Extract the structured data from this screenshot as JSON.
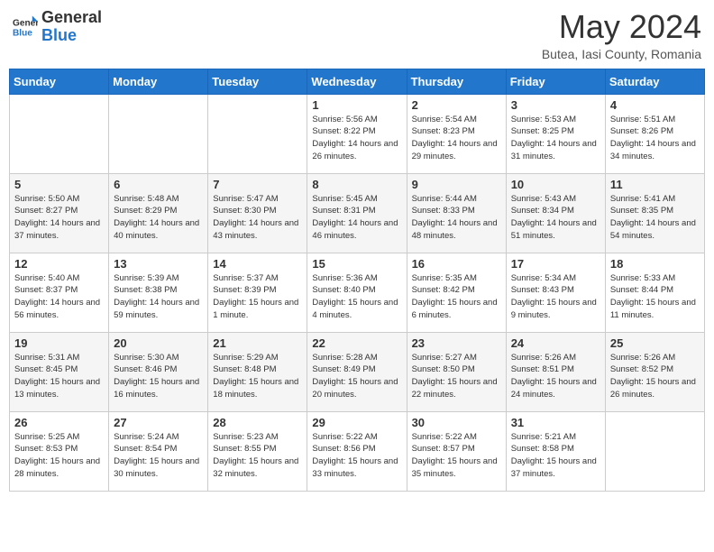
{
  "header": {
    "logo_text_general": "General",
    "logo_text_blue": "Blue",
    "month": "May 2024",
    "location": "Butea, Iasi County, Romania"
  },
  "weekdays": [
    "Sunday",
    "Monday",
    "Tuesday",
    "Wednesday",
    "Thursday",
    "Friday",
    "Saturday"
  ],
  "weeks": [
    [
      {
        "day": "",
        "info": ""
      },
      {
        "day": "",
        "info": ""
      },
      {
        "day": "",
        "info": ""
      },
      {
        "day": "1",
        "info": "Sunrise: 5:56 AM\nSunset: 8:22 PM\nDaylight: 14 hours\nand 26 minutes."
      },
      {
        "day": "2",
        "info": "Sunrise: 5:54 AM\nSunset: 8:23 PM\nDaylight: 14 hours\nand 29 minutes."
      },
      {
        "day": "3",
        "info": "Sunrise: 5:53 AM\nSunset: 8:25 PM\nDaylight: 14 hours\nand 31 minutes."
      },
      {
        "day": "4",
        "info": "Sunrise: 5:51 AM\nSunset: 8:26 PM\nDaylight: 14 hours\nand 34 minutes."
      }
    ],
    [
      {
        "day": "5",
        "info": "Sunrise: 5:50 AM\nSunset: 8:27 PM\nDaylight: 14 hours\nand 37 minutes."
      },
      {
        "day": "6",
        "info": "Sunrise: 5:48 AM\nSunset: 8:29 PM\nDaylight: 14 hours\nand 40 minutes."
      },
      {
        "day": "7",
        "info": "Sunrise: 5:47 AM\nSunset: 8:30 PM\nDaylight: 14 hours\nand 43 minutes."
      },
      {
        "day": "8",
        "info": "Sunrise: 5:45 AM\nSunset: 8:31 PM\nDaylight: 14 hours\nand 46 minutes."
      },
      {
        "day": "9",
        "info": "Sunrise: 5:44 AM\nSunset: 8:33 PM\nDaylight: 14 hours\nand 48 minutes."
      },
      {
        "day": "10",
        "info": "Sunrise: 5:43 AM\nSunset: 8:34 PM\nDaylight: 14 hours\nand 51 minutes."
      },
      {
        "day": "11",
        "info": "Sunrise: 5:41 AM\nSunset: 8:35 PM\nDaylight: 14 hours\nand 54 minutes."
      }
    ],
    [
      {
        "day": "12",
        "info": "Sunrise: 5:40 AM\nSunset: 8:37 PM\nDaylight: 14 hours\nand 56 minutes."
      },
      {
        "day": "13",
        "info": "Sunrise: 5:39 AM\nSunset: 8:38 PM\nDaylight: 14 hours\nand 59 minutes."
      },
      {
        "day": "14",
        "info": "Sunrise: 5:37 AM\nSunset: 8:39 PM\nDaylight: 15 hours\nand 1 minute."
      },
      {
        "day": "15",
        "info": "Sunrise: 5:36 AM\nSunset: 8:40 PM\nDaylight: 15 hours\nand 4 minutes."
      },
      {
        "day": "16",
        "info": "Sunrise: 5:35 AM\nSunset: 8:42 PM\nDaylight: 15 hours\nand 6 minutes."
      },
      {
        "day": "17",
        "info": "Sunrise: 5:34 AM\nSunset: 8:43 PM\nDaylight: 15 hours\nand 9 minutes."
      },
      {
        "day": "18",
        "info": "Sunrise: 5:33 AM\nSunset: 8:44 PM\nDaylight: 15 hours\nand 11 minutes."
      }
    ],
    [
      {
        "day": "19",
        "info": "Sunrise: 5:31 AM\nSunset: 8:45 PM\nDaylight: 15 hours\nand 13 minutes."
      },
      {
        "day": "20",
        "info": "Sunrise: 5:30 AM\nSunset: 8:46 PM\nDaylight: 15 hours\nand 16 minutes."
      },
      {
        "day": "21",
        "info": "Sunrise: 5:29 AM\nSunset: 8:48 PM\nDaylight: 15 hours\nand 18 minutes."
      },
      {
        "day": "22",
        "info": "Sunrise: 5:28 AM\nSunset: 8:49 PM\nDaylight: 15 hours\nand 20 minutes."
      },
      {
        "day": "23",
        "info": "Sunrise: 5:27 AM\nSunset: 8:50 PM\nDaylight: 15 hours\nand 22 minutes."
      },
      {
        "day": "24",
        "info": "Sunrise: 5:26 AM\nSunset: 8:51 PM\nDaylight: 15 hours\nand 24 minutes."
      },
      {
        "day": "25",
        "info": "Sunrise: 5:26 AM\nSunset: 8:52 PM\nDaylight: 15 hours\nand 26 minutes."
      }
    ],
    [
      {
        "day": "26",
        "info": "Sunrise: 5:25 AM\nSunset: 8:53 PM\nDaylight: 15 hours\nand 28 minutes."
      },
      {
        "day": "27",
        "info": "Sunrise: 5:24 AM\nSunset: 8:54 PM\nDaylight: 15 hours\nand 30 minutes."
      },
      {
        "day": "28",
        "info": "Sunrise: 5:23 AM\nSunset: 8:55 PM\nDaylight: 15 hours\nand 32 minutes."
      },
      {
        "day": "29",
        "info": "Sunrise: 5:22 AM\nSunset: 8:56 PM\nDaylight: 15 hours\nand 33 minutes."
      },
      {
        "day": "30",
        "info": "Sunrise: 5:22 AM\nSunset: 8:57 PM\nDaylight: 15 hours\nand 35 minutes."
      },
      {
        "day": "31",
        "info": "Sunrise: 5:21 AM\nSunset: 8:58 PM\nDaylight: 15 hours\nand 37 minutes."
      },
      {
        "day": "",
        "info": ""
      }
    ]
  ]
}
